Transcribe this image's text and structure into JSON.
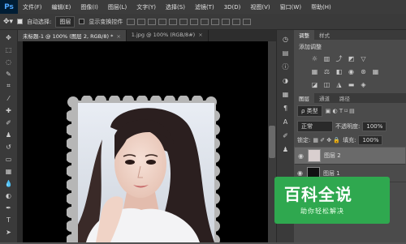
{
  "app": {
    "logo_text": "Ps"
  },
  "menu": [
    "文件(F)",
    "编辑(E)",
    "图像(I)",
    "图层(L)",
    "文字(Y)",
    "选择(S)",
    "滤镜(T)",
    "3D(D)",
    "视图(V)",
    "窗口(W)",
    "帮助(H)"
  ],
  "options_bar": {
    "auto_select_label": "自动选择:",
    "auto_select_value": "图层",
    "show_transform_label": "显示变换控件"
  },
  "doc_tabs": [
    {
      "label": "未标题-1 @ 100% (图层 2, RGB/8) *",
      "close": "×"
    },
    {
      "label": "1.jpg @ 100% (RGB/8#)",
      "close": "×"
    }
  ],
  "panels": {
    "adjust_tabs": [
      "调整",
      "样式"
    ],
    "adjust_title": "添加调整",
    "layers_tabs": [
      "图层",
      "通道",
      "路径"
    ],
    "kind_filter": "ρ 类型",
    "blend_mode": "正常",
    "opacity_label": "不透明度:",
    "opacity_value": "100%",
    "lock_label": "锁定:",
    "fill_label": "填充:",
    "fill_value": "100%",
    "layers": [
      {
        "name": "图层 2",
        "selected": true
      },
      {
        "name": "图层 1",
        "selected": false
      }
    ]
  },
  "watermark": {
    "title": "百科全说",
    "subtitle": "助你轻松解决"
  },
  "colors": {
    "accent": "#2fa84f",
    "canvas": "#000000",
    "frame": "#b6b6b6"
  }
}
